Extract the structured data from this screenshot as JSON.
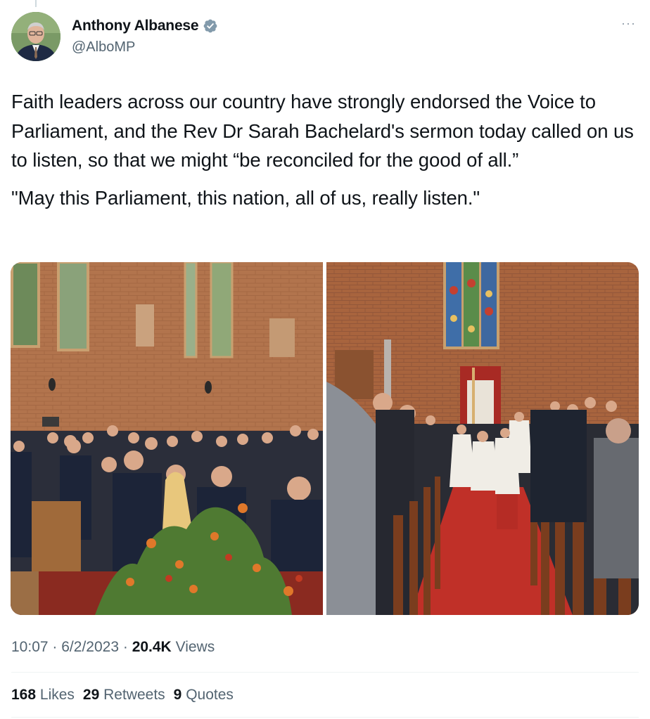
{
  "author": {
    "display_name": "Anthony Albanese",
    "handle": "@AlboMP",
    "verified": true,
    "avatar_icon": "profile-photo"
  },
  "tweet": {
    "paragraph_1": "Faith leaders across our country have strongly endorsed the Voice to Parliament, and the Rev Dr Sarah Bachelard's sermon today called on us to listen, so that we might “be reconciled for the good of all.”",
    "paragraph_2": "\"May this Parliament, this nation, all of us, really listen.\""
  },
  "media": {
    "photos": [
      "church-congregation-photo",
      "church-procession-photo"
    ]
  },
  "meta": {
    "time": "10:07",
    "date": "6/2/2023",
    "views_count": "20.4K",
    "views_label": "Views",
    "separator": "·"
  },
  "stats": {
    "likes_count": "168",
    "likes_label": "Likes",
    "retweets_count": "29",
    "retweets_label": "Retweets",
    "quotes_count": "9",
    "quotes_label": "Quotes"
  },
  "colors": {
    "verified": "#829aab",
    "secondary_text": "#536471",
    "primary_text": "#0f1419"
  }
}
